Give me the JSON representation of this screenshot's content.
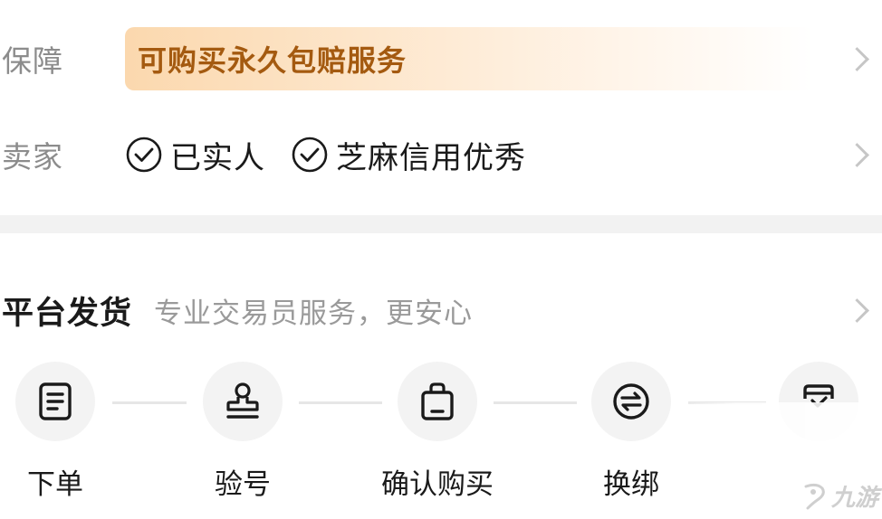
{
  "guarantee": {
    "label": "保障",
    "service_text": "可购买永久包赔服务"
  },
  "seller": {
    "label": "卖家",
    "badges": [
      {
        "text": "已实人",
        "icon": "check-circle-icon"
      },
      {
        "text": "芝麻信用优秀",
        "icon": "check-circle-icon"
      }
    ]
  },
  "platform_delivery": {
    "title": "平台发货",
    "subtitle": "专业交易员服务，更安心"
  },
  "steps": [
    {
      "label": "下单",
      "icon": "order-document-icon"
    },
    {
      "label": "验号",
      "icon": "stamp-icon"
    },
    {
      "label": "确认购买",
      "icon": "shopping-bag-icon"
    },
    {
      "label": "换绑",
      "icon": "swap-arrows-icon"
    },
    {
      "label": "",
      "icon": "inbox-check-icon"
    }
  ],
  "watermark": {
    "text": "九游"
  },
  "colors": {
    "guarantee_text": "#a45a10",
    "guarantee_bg": "#fbd8ae",
    "label_gray": "#8c8c8c",
    "divider": "#f2f2f2"
  }
}
